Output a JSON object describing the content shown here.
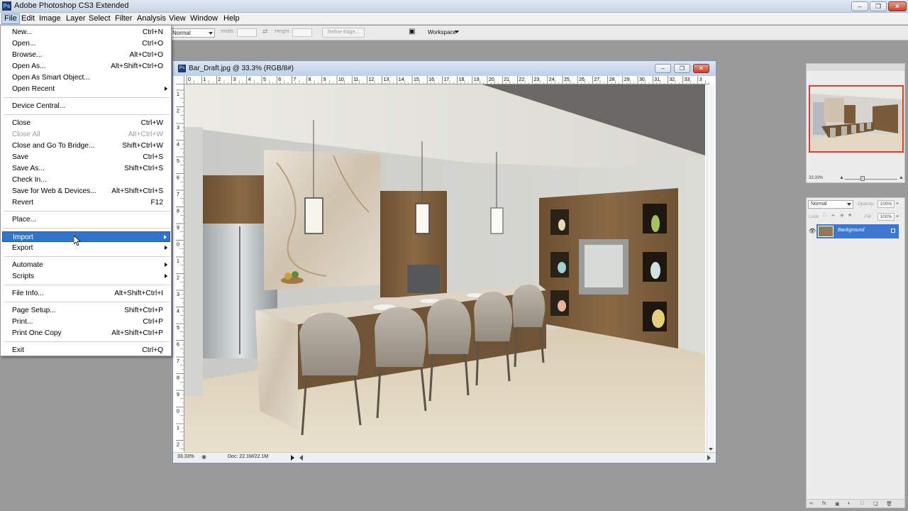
{
  "app": {
    "title": "Adobe Photoshop CS3 Extended"
  },
  "menubar": [
    "File",
    "Edit",
    "Image",
    "Layer",
    "Select",
    "Filter",
    "Analysis",
    "View",
    "Window",
    "Help"
  ],
  "options_bar": {
    "mode_value": "Normal",
    "width_label": "Width:",
    "height_label": "Height:",
    "refine_edge_label": "Refine Edge...",
    "workspace_label": "Workspace"
  },
  "document": {
    "title": "Bar_Draft.jpg @ 33.3% (RGB/8#)",
    "zoom": "33.33%",
    "doc_info": "Doc: 22.1M/22.1M",
    "ruler_top": [
      "0",
      "1",
      "2",
      "3",
      "4",
      "5",
      "6",
      "7",
      "8",
      "9",
      "10",
      "11",
      "12",
      "13",
      "14",
      "15",
      "16",
      "17",
      "18",
      "19",
      "20",
      "21",
      "22",
      "23",
      "24",
      "25",
      "26",
      "27",
      "28",
      "29",
      "30",
      "31",
      "32",
      "33",
      "3"
    ],
    "ruler_left": [
      "1",
      "2",
      "3",
      "4",
      "5",
      "6",
      "7",
      "8",
      "9",
      "0",
      "1",
      "2",
      "3",
      "4",
      "5",
      "6",
      "7",
      "8",
      "9",
      "0",
      "1",
      "2"
    ]
  },
  "file_menu": {
    "items": [
      {
        "label": "New...",
        "shortcut": "Ctrl+N"
      },
      {
        "label": "Open...",
        "shortcut": "Ctrl+O"
      },
      {
        "label": "Browse...",
        "shortcut": "Alt+Ctrl+O"
      },
      {
        "label": "Open As...",
        "shortcut": "Alt+Shift+Ctrl+O"
      },
      {
        "label": "Open As Smart Object...",
        "shortcut": ""
      },
      {
        "label": "Open Recent",
        "shortcut": "",
        "submenu": true
      },
      {
        "sep": true
      },
      {
        "label": "Device Central...",
        "shortcut": ""
      },
      {
        "sep": true
      },
      {
        "label": "Close",
        "shortcut": "Ctrl+W"
      },
      {
        "label": "Close All",
        "shortcut": "Alt+Ctrl+W",
        "disabled": true
      },
      {
        "label": "Close and Go To Bridge...",
        "shortcut": "Shift+Ctrl+W"
      },
      {
        "label": "Save",
        "shortcut": "Ctrl+S"
      },
      {
        "label": "Save As...",
        "shortcut": "Shift+Ctrl+S"
      },
      {
        "label": "Check In...",
        "shortcut": ""
      },
      {
        "label": "Save for Web & Devices...",
        "shortcut": "Alt+Shift+Ctrl+S"
      },
      {
        "label": "Revert",
        "shortcut": "F12"
      },
      {
        "sep": true
      },
      {
        "label": "Place...",
        "shortcut": ""
      },
      {
        "sep": true
      },
      {
        "label": "Import",
        "shortcut": "",
        "submenu": true,
        "highlight": true
      },
      {
        "label": "Export",
        "shortcut": "",
        "submenu": true
      },
      {
        "sep": true
      },
      {
        "label": "Automate",
        "shortcut": "",
        "submenu": true
      },
      {
        "label": "Scripts",
        "shortcut": "",
        "submenu": true
      },
      {
        "sep": true
      },
      {
        "label": "File Info...",
        "shortcut": "Alt+Shift+Ctrl+I"
      },
      {
        "sep": true
      },
      {
        "label": "Page Setup...",
        "shortcut": "Shift+Ctrl+P"
      },
      {
        "label": "Print...",
        "shortcut": "Ctrl+P"
      },
      {
        "label": "Print One Copy",
        "shortcut": "Alt+Shift+Ctrl+P"
      },
      {
        "sep": true
      },
      {
        "label": "Exit",
        "shortcut": "Ctrl+Q"
      }
    ]
  },
  "navigator": {
    "zoom": "33.33%"
  },
  "layers": {
    "blend_mode": "Normal",
    "opacity_label": "Opacity:",
    "opacity_value": "100%",
    "lock_label": "Lock:",
    "fill_label": "Fill:",
    "fill_value": "100%",
    "layer_name": "Background"
  },
  "colors": {
    "menu_highlight": "#3175c9",
    "workspace_bg": "#9a9a9a",
    "navigator_frame": "#e03a3a"
  }
}
